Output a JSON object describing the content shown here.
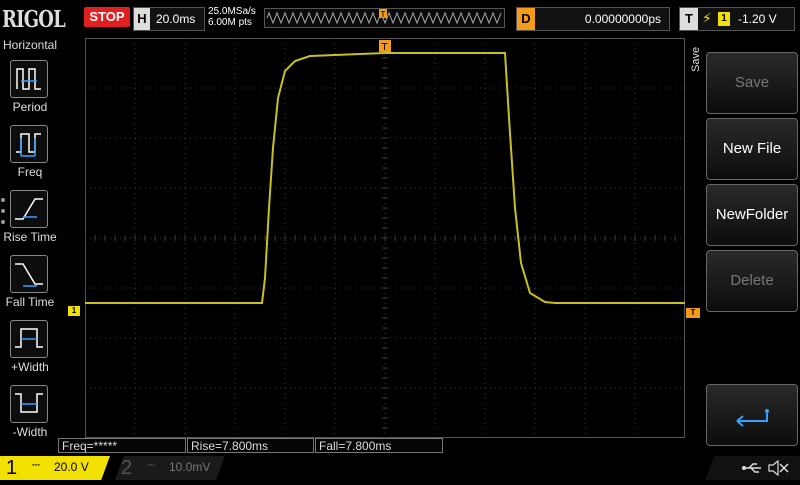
{
  "brand": "RIGOL",
  "run_state": "STOP",
  "horizontal": {
    "label": "H",
    "timebase": "20.0ms"
  },
  "acquisition": {
    "sample_rate": "25.0MSa/s",
    "points": "6.00M pts"
  },
  "delay": {
    "label": "D",
    "value": "0.00000000ps"
  },
  "trigger": {
    "label": "T",
    "source": "1",
    "level": "-1.20 V",
    "marker": "T"
  },
  "left_menu": {
    "title": "Horizontal",
    "items": [
      {
        "label": "Period",
        "icon": "period-icon"
      },
      {
        "label": "Freq",
        "icon": "frequency-icon"
      },
      {
        "label": "Rise Time",
        "icon": "rise-time-icon"
      },
      {
        "label": "Fall Time",
        "icon": "fall-time-icon"
      },
      {
        "label": "+Width",
        "icon": "positive-width-icon"
      },
      {
        "label": "-Width",
        "icon": "negative-width-icon"
      }
    ]
  },
  "right_menu": {
    "title": "Save",
    "buttons": [
      {
        "label": "Save",
        "enabled": false
      },
      {
        "label": "New File",
        "enabled": true
      },
      {
        "label": "NewFolder",
        "enabled": true
      },
      {
        "label": "Delete",
        "enabled": false
      }
    ],
    "return_icon": "return-arrow-icon"
  },
  "measurements": [
    {
      "text": "Freq=*****"
    },
    {
      "text": "Rise=7.800ms"
    },
    {
      "text": "Fall=7.800ms"
    }
  ],
  "channels": [
    {
      "number": "1",
      "coupling_symbol": "⎓",
      "scale": "20.0 V",
      "color": "#f1e000",
      "active": true
    },
    {
      "number": "2",
      "coupling_symbol": "⎓",
      "scale": "10.0mV",
      "color": "#555555",
      "active": false
    }
  ],
  "channel1_marker": "1",
  "colors": {
    "trace": "#c8c020",
    "stop": "#e02020",
    "delay": "#f39c1a",
    "grid": "#3a3a3a"
  },
  "status_icons": [
    "usb-icon",
    "speaker-muted-icon"
  ]
}
